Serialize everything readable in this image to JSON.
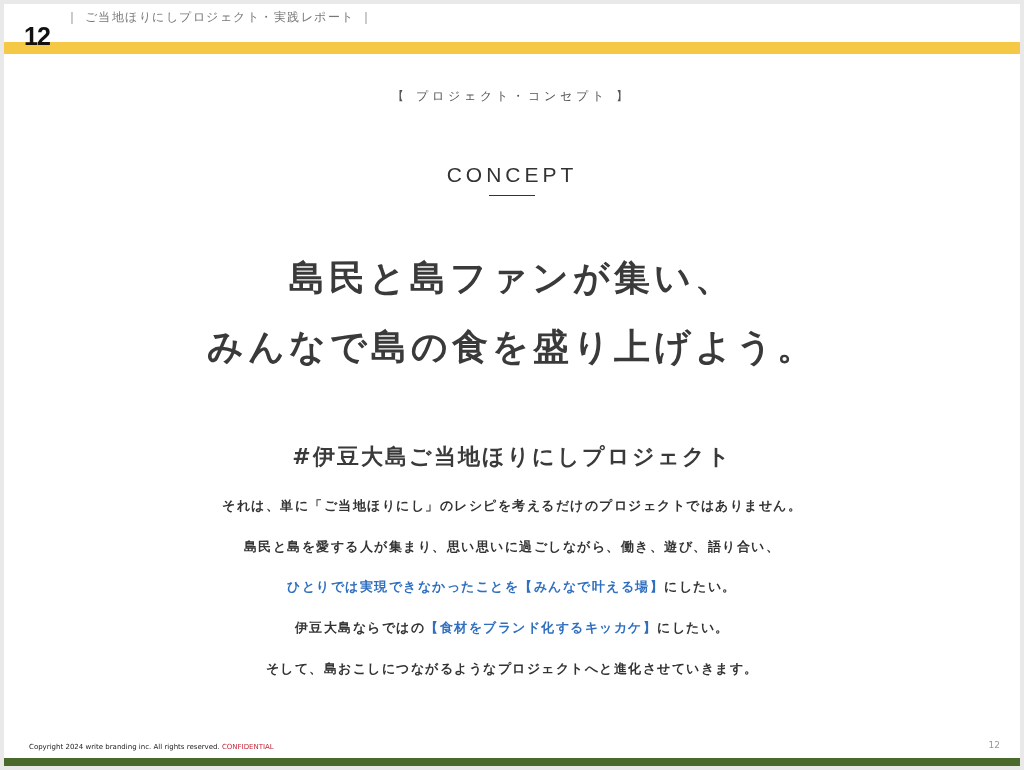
{
  "header": {
    "page_number": "12",
    "series_title": "｜ ご当地ほりにしプロジェクト・実践レポート ｜"
  },
  "section_label": "【 プロジェクト・コンセプト 】",
  "heading": "CONCEPT",
  "headline": [
    "島民と島ファンが集い、",
    "みんなで島の食を盛り上げよう。"
  ],
  "hashtag": "#伊豆大島ご当地ほりにしプロジェクト",
  "body": [
    [
      {
        "text": "それは、単に「ご当地ほりにし」のレシピを考えるだけのプロジェクトではありません。",
        "highlight": false
      }
    ],
    [
      {
        "text": "島民と島を愛する人が集まり、思い思いに過ごしながら、働き、遊び、語り合い、",
        "highlight": false
      }
    ],
    [
      {
        "text": "ひとりでは実現できなかったことを【みんなで叶える場】",
        "highlight": true
      },
      {
        "text": "にしたい。",
        "highlight": false
      }
    ],
    [
      {
        "text": "伊豆大島ならではの",
        "highlight": false
      },
      {
        "text": "【食材をブランド化するキッカケ】",
        "highlight": true
      },
      {
        "text": "にしたい。",
        "highlight": false
      }
    ],
    [
      {
        "text": "そして、島おこしにつながるようなプロジェクトへと進化させていきます。",
        "highlight": false
      }
    ]
  ],
  "footer": {
    "copyright": "Copyright 2024 write branding inc. All rights reserved.",
    "confidential": "CONFIDENTIAL",
    "page_number": "12"
  }
}
